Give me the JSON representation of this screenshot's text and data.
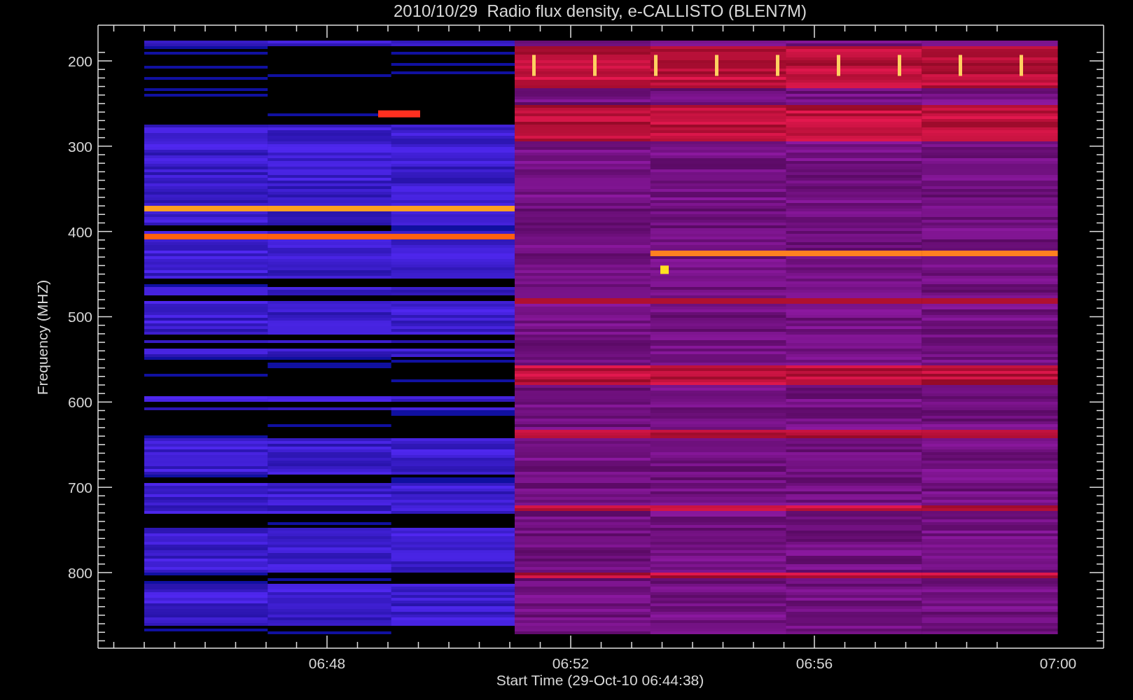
{
  "title": "2010/10/29  Radio flux density, e-CALLISTO (BLEN7M)",
  "y_axis": {
    "label": "Frequency (MHZ)",
    "ticks": [
      "200",
      "300",
      "400",
      "500",
      "600",
      "700",
      "800"
    ]
  },
  "x_axis": {
    "label": "Start Time (29-Oct-10 06:44:38)",
    "ticks": [
      "06:48",
      "06:52",
      "06:56",
      "07:00"
    ]
  }
}
